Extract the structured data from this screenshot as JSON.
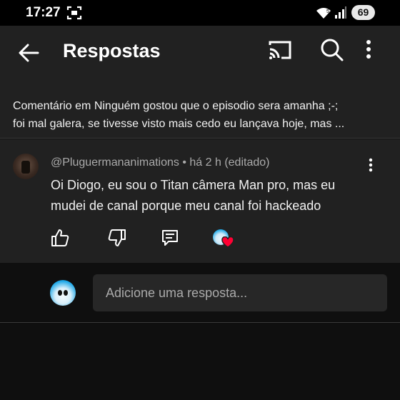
{
  "status_bar": {
    "time": "17:27",
    "battery": "69",
    "icons": [
      "screenshot-icon",
      "wifi-icon",
      "signal-icon",
      "battery-icon"
    ]
  },
  "header": {
    "title": "Respostas",
    "icons": [
      "back-arrow-icon",
      "cast-icon",
      "search-icon",
      "more-vert-icon"
    ]
  },
  "context": {
    "line1": "Comentário em Ninguém gostou que o episodio sera amanha ;-;",
    "line2": "foi mal galera, se tivesse visto mais cedo eu lançava hoje, mas ..."
  },
  "comment": {
    "meta": "@Pluguermananimations • há 2 h (editado)",
    "text": "Oi Diogo, eu sou o Titan câmera Man pro, mas eu mudei de canal porque meu canal foi hackeado",
    "actions": [
      "like-icon",
      "dislike-icon",
      "reply-icon",
      "creator-heart-icon"
    ]
  },
  "reply_bar": {
    "placeholder": "Adicione uma resposta..."
  },
  "colors": {
    "background": "#0f0f0f",
    "surface": "#212121",
    "input": "#272727",
    "text": "#f1f1f1",
    "secondary_text": "#aaaaaa",
    "heart": "#ff0033"
  }
}
